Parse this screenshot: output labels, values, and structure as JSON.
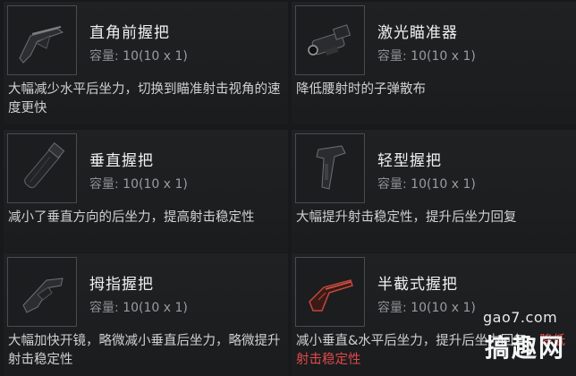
{
  "items": [
    {
      "name": "直角前握把",
      "cap_label": "容量:",
      "cap_value": "10(10 x 1)",
      "desc": "大幅减少水平后坐力，切换到瞄准射击视角的速度更快",
      "desc_red": "",
      "icon": "angled-grip-icon",
      "color": "#3a3d40"
    },
    {
      "name": "激光瞄准器",
      "cap_label": "容量:",
      "cap_value": "10(10 x 1)",
      "desc": "降低腰射时的子弹散布",
      "desc_red": "",
      "icon": "laser-sight-icon",
      "color": "#3a3d40"
    },
    {
      "name": "垂直握把",
      "cap_label": "容量:",
      "cap_value": "10(10 x 1)",
      "desc": "减小了垂直方向的后坐力，提高射击稳定性",
      "desc_red": "",
      "icon": "vertical-grip-icon",
      "color": "#3a3d40"
    },
    {
      "name": "轻型握把",
      "cap_label": "容量:",
      "cap_value": "10(10 x 1)",
      "desc": "大幅提升射击稳定性，提升后坐力回复",
      "desc_red": "",
      "icon": "light-grip-icon",
      "color": "#3a3d40"
    },
    {
      "name": "拇指握把",
      "cap_label": "容量:",
      "cap_value": "10(10 x 1)",
      "desc": "大幅加快开镜，略微减小垂直后坐力，略微提升射击稳定性",
      "desc_red": "",
      "icon": "thumb-grip-icon",
      "color": "#3a3d40"
    },
    {
      "name": "半截式握把",
      "cap_label": "容量:",
      "cap_value": "10(10 x 1)",
      "desc": "减小垂直&水平后坐力，提升后坐力回复，",
      "desc_red": "降低射击稳定性",
      "icon": "half-grip-icon",
      "color": "#c2483c"
    }
  ],
  "watermark": {
    "site": "gao7.com",
    "brand": "搞趣网"
  }
}
